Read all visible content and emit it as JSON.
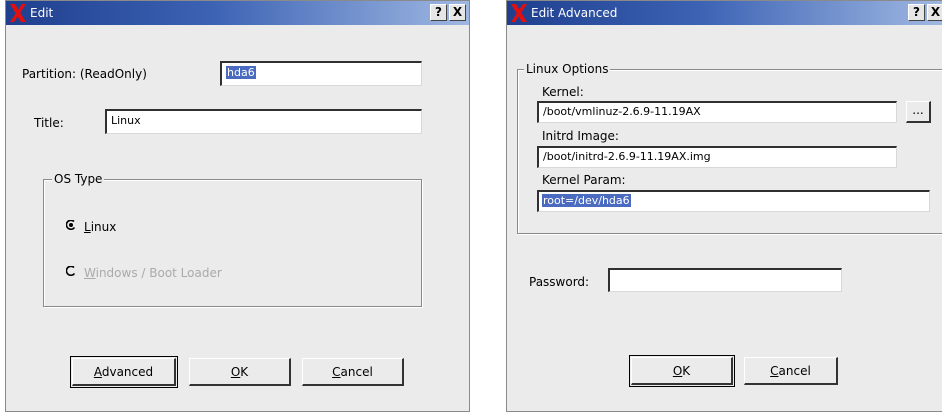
{
  "edit_dialog": {
    "title": "Edit",
    "help_btn": "?",
    "close_btn": "X",
    "partition_label": "Partition: (ReadOnly)",
    "partition_value": "hda6",
    "title_label": "Title:",
    "title_value": "Linux",
    "os_type_group": "OS Type",
    "radio_linux": {
      "underline": "L",
      "rest": "inux",
      "checked": true
    },
    "radio_windows": {
      "underline": "W",
      "rest": "indows / Boot Loader",
      "checked": false,
      "disabled": true
    },
    "btn_advanced": {
      "underline": "A",
      "rest": "dvanced"
    },
    "btn_ok": {
      "underline": "O",
      "rest": "K"
    },
    "btn_cancel": {
      "underline": "C",
      "rest": "ancel"
    }
  },
  "advanced_dialog": {
    "title": "Edit Advanced",
    "help_btn": "?",
    "close_btn": "X",
    "linux_options_group": "Linux Options",
    "kernel_label": "Kernel:",
    "kernel_value": "/boot/vmlinuz-2.6.9-11.19AX",
    "browse_btn": "...",
    "initrd_label": "Initrd Image:",
    "initrd_value": "/boot/initrd-2.6.9-11.19AX.img",
    "kernel_param_label": "Kernel Param:",
    "kernel_param_value": "root=/dev/hda6",
    "password_label": "Password:",
    "password_value": "",
    "btn_ok": {
      "underline": "O",
      "rest": "K"
    },
    "btn_cancel": {
      "underline": "C",
      "rest": "ancel"
    }
  },
  "colors": {
    "titlebar_start": "#1f3f8e",
    "titlebar_end": "#9fb8e2",
    "dialog_bg": "#ebebeb",
    "selection": "#4a6bbf",
    "x_logo": "#e01010"
  }
}
